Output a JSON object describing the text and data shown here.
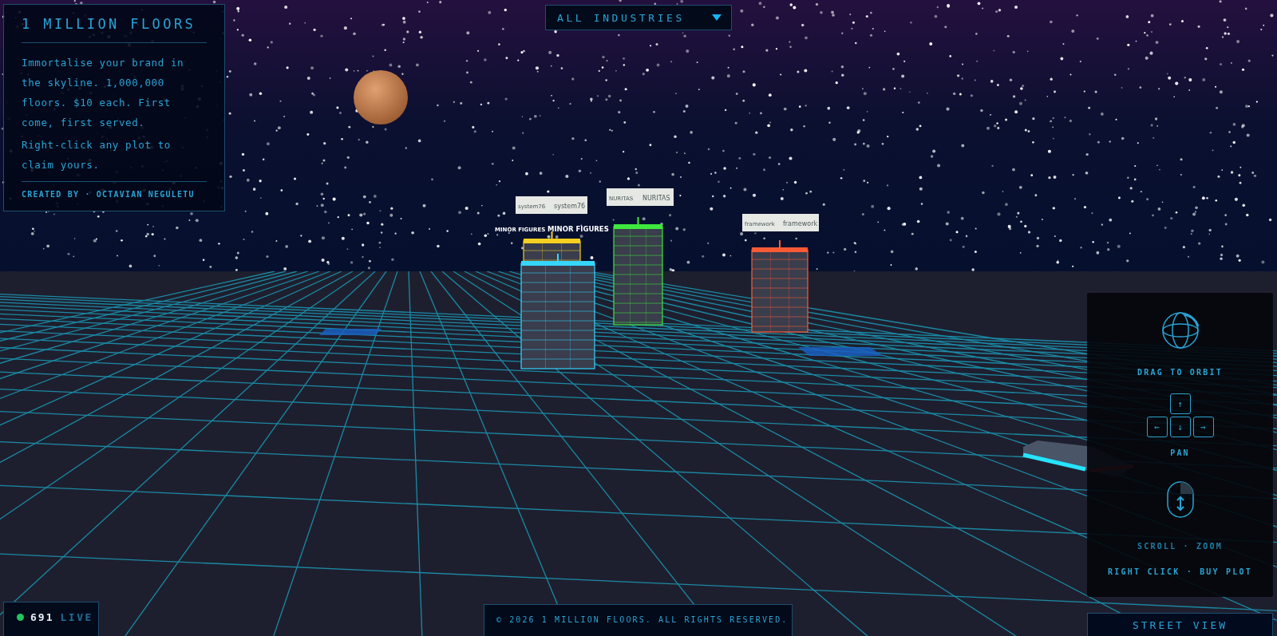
{
  "info_panel": {
    "title": "1 MILLION FLOORS",
    "paragraphs": [
      "Immortalise your brand in the skyline. 1,000,000 floors. $10 each. First come, first served.",
      "Right-click any plot to claim yours."
    ],
    "credit": "CREATED BY · OCTAVIAN NEGULETU"
  },
  "industry_filter": {
    "value": "ALL INDUSTRIES"
  },
  "buildings": [
    {
      "kind": "board",
      "signs": [
        "system76",
        "system76"
      ],
      "color": "#35d6ff"
    },
    {
      "kind": "glow",
      "signs": [
        "MINOR FIGURES",
        "MINOR FIGURES"
      ],
      "color": "#f5d020"
    },
    {
      "kind": "board",
      "signs": [
        "NURITAS",
        "NURITAS"
      ],
      "color": "#3ee83e"
    },
    {
      "kind": "board",
      "signs": [
        "framework",
        "framework"
      ],
      "color": "#ff5a36"
    }
  ],
  "controls_panel": {
    "orbit_label": "DRAG TO ORBIT",
    "pan_keys": [
      "↑",
      "←",
      "↓",
      "→"
    ],
    "pan_label": "PAN",
    "zoom_label": "SCROLL · ZOOM",
    "buy_label": "RIGHT CLICK · BUY PLOT"
  },
  "street_view_button": "STREET VIEW",
  "live_status": {
    "online": true,
    "count": "691",
    "label": "LIVE"
  },
  "footer": "© 2026 1 MILLION FLOORS. ALL RIGHTS RESERVED."
}
